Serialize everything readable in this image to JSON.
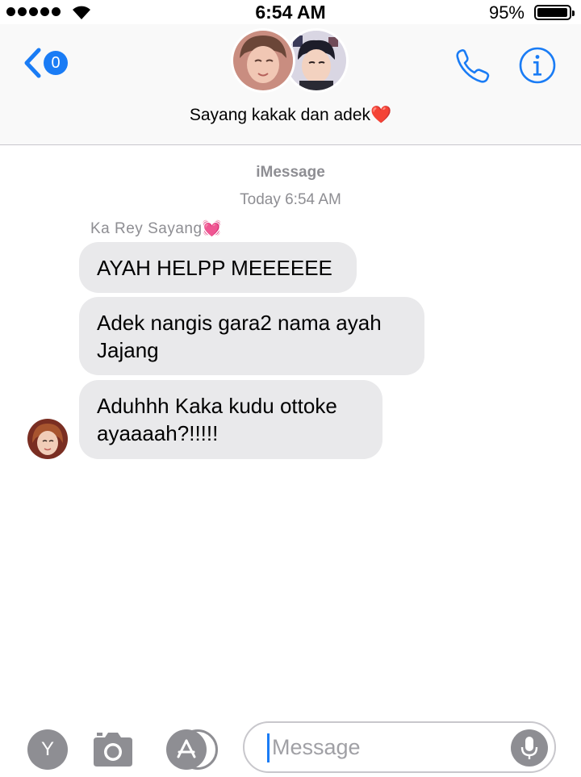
{
  "status_bar": {
    "time": "6:54 AM",
    "battery_percent": "95%"
  },
  "header": {
    "back_badge_count": "0",
    "group_name": "Sayang kakak dan adek❤️"
  },
  "conversation": {
    "service_label": "iMessage",
    "timestamp": "Today 6:54 AM",
    "sender_name": "Ka Rey Sayang💓",
    "messages": [
      {
        "text": "AYAH HELPP MEEEEEE"
      },
      {
        "text": "Adek nangis gara2 nama ayah Jajang"
      },
      {
        "text": "Aduhhh Kaka kudu ottoke ayaaaah?!!!!!"
      }
    ]
  },
  "input_bar": {
    "y_button_label": "Y",
    "message_placeholder": "Message"
  },
  "colors": {
    "accent": "#1a7cf5",
    "bubble_gray": "#e9e9eb",
    "secondary_text": "#8e8e93"
  }
}
